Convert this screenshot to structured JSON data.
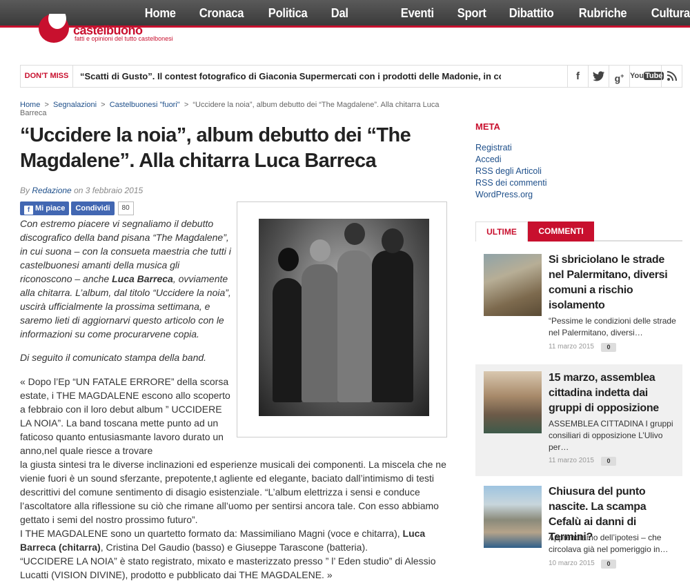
{
  "nav": [
    "Home",
    "Cronaca",
    "Politica",
    "Dal Comune",
    "Eventi",
    "Sport",
    "Dibattito",
    "Rubriche",
    "Cultura"
  ],
  "logo": {
    "name": "castelbuono",
    "tagline": "fatti e opinioni del tutto castelbonesi"
  },
  "dontmiss": {
    "label": "DON'T MISS",
    "text": "“Scatti di Gusto”. Il contest fotografico di Giaconia Supermercati con i prodotti delle Madonie, in colla"
  },
  "social": [
    "f",
    "twitter",
    "g+",
    "YouTube",
    "rss"
  ],
  "breadcrumb": {
    "home": "Home",
    "sep": ">",
    "c1": "Segnalazioni",
    "c2": "Castelbuonesi \"fuori\"",
    "current": "“Uccidere la noia”, album debutto dei “The Magdalene”. Alla chitarra Luca Barreca"
  },
  "article": {
    "title": "“Uccidere la noia”, album debutto dei “The Magdalene”. Alla chitarra Luca Barreca",
    "by": "By",
    "author": "Redazione",
    "on": "on",
    "date": "3 febbraio 2015",
    "like": "Mi piace",
    "share": "Condividi",
    "share_count": "80",
    "p1a": "Con estremo piacere vi segnaliamo il debutto discografico della band pisana “The Magdalene”, in cui suona – con la consueta maestria che tutti i castelbuonesi amanti della musica gli riconoscono – anche ",
    "p1b": "Luca Barreca",
    "p1c": ", ovviamente alla chitarra. L’album, dal titolo “Uccidere la noia”, uscirà ufficialmente la prossima settimana, e saremo lieti di aggiornarvi questo articolo con le informazioni su come procurarvene copia.",
    "p2": "Di seguito il comunicato stampa della band.",
    "p3a": "« Dopo l’Ep “UN FATALE ERRORE” della scorsa estate, i THE MAGDALENE escono allo scoperto a febbraio con il loro debut album ” UCCIDERE LA NOIA”. La band toscana mette punto ad un faticoso quanto entusiasmante lavoro durato un anno,nel quale riesce a trovare",
    "p3b": "la giusta sintesi tra le diverse inclinazioni ed esperienze musicali dei componenti. La miscela che ne vienie fuori è un sound sferzante, prepotente,t agliente ed elegante, baciato dall’intimismo di testi descrittivi del comune sentimento di disagio esistenziale. “L’album elettrizza i sensi e conduce l’ascoltatore alla riflessione su ciò che rimane all’uomo per sentirsi ancora tale. Con esso abbiamo gettato i semi del nostro prossimo futuro”.",
    "p4a": "I THE MAGDALENE sono un quartetto formato da: Massimiliano Magni (voce e chitarra), ",
    "p4b": "Luca Barreca (chitarra)",
    "p4c": ", Cristina Del Gaudio (basso) e Giuseppe Tarascone (batteria).",
    "p5": "“UCCIDERE LA NOIA” è stato registrato, mixato e masterizzato presso ” l’ Eden studio” di Alessio Lucatti (VISION DIVINE), prodotto e pubblicato dai THE MAGDALENE. »"
  },
  "meta": {
    "heading": "META",
    "links": [
      "Registrati",
      "Accedi",
      "RSS degli Articoli",
      "RSS dei commenti",
      "WordPress.org"
    ]
  },
  "tabs": [
    "ULTIME",
    "COMMENTI"
  ],
  "posts": [
    {
      "title": "Si sbriciolano le strade nel Palermitano, diversi comuni a rischio isolamento",
      "excerpt": "“Pessime le condizioni delle strade nel Palermitano, diversi…",
      "date": "11 marzo 2015",
      "comments": "0"
    },
    {
      "title": "15 marzo, assemblea cittadina indetta dai gruppi di opposizione",
      "excerpt": "ASSEMBLEA CITTADINA I gruppi consiliari di opposizione L’Ulivo per…",
      "date": "11 marzo 2015",
      "comments": "0"
    },
    {
      "title": "Chiusura del punto nascite. La scampa Cefalù ai danni di Termini?",
      "excerpt": "Apprendiamo dell’ipotesi – che circolava già nel pomeriggio in…",
      "date": "10 marzo 2015",
      "comments": "0"
    }
  ]
}
